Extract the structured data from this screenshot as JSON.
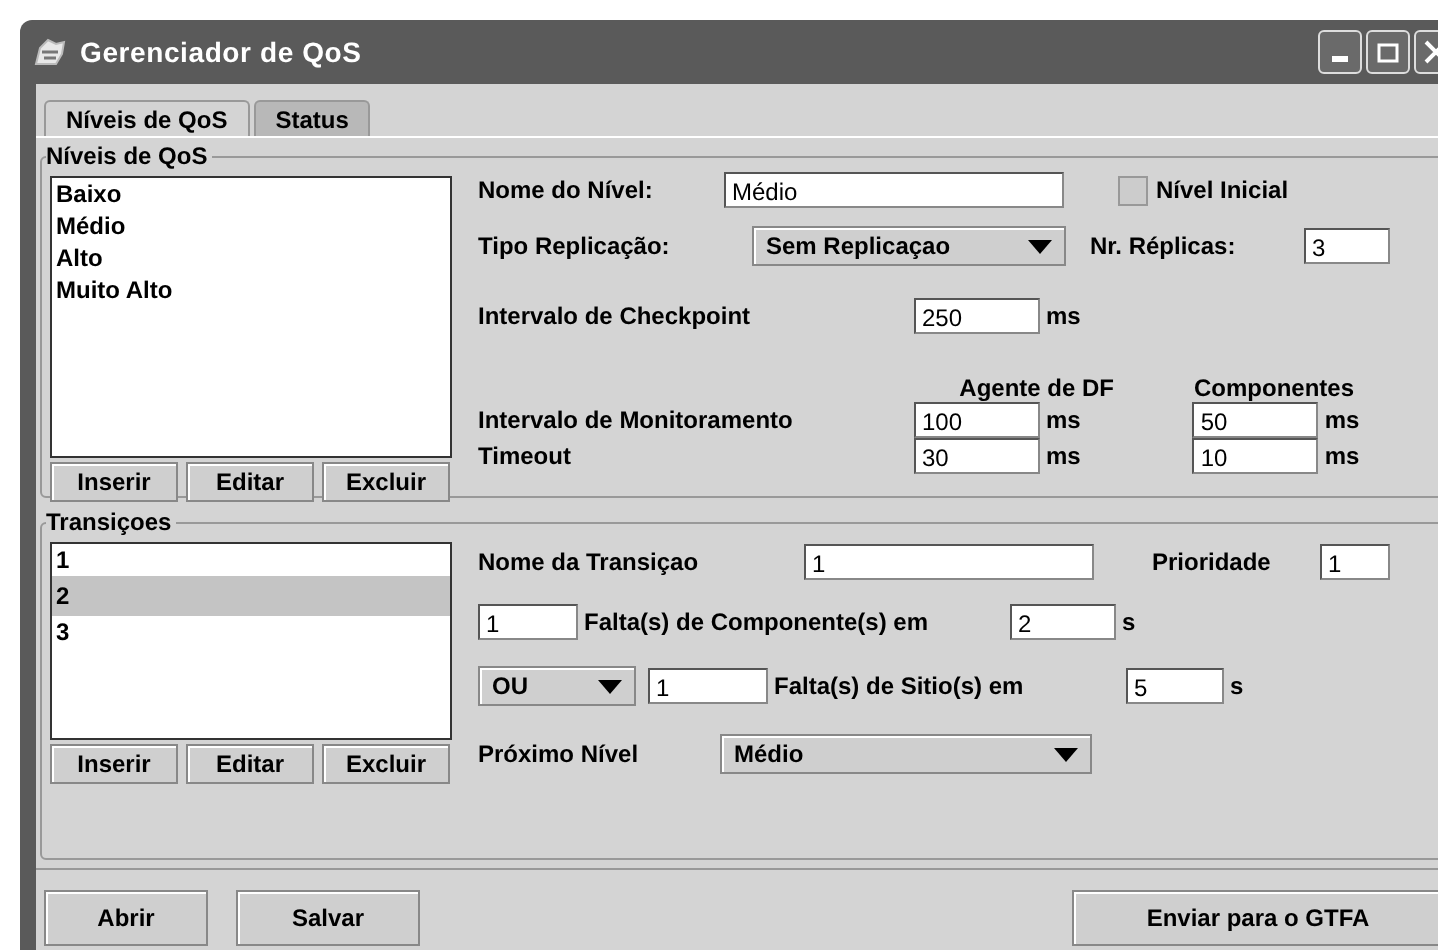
{
  "window": {
    "title": "Gerenciador de QoS"
  },
  "tabs": [
    {
      "label": "Níveis de QoS",
      "selected": true
    },
    {
      "label": "Status",
      "selected": false
    }
  ],
  "levels": {
    "title": "Níveis de QoS",
    "list": [
      {
        "label": "Baixo",
        "selected": false
      },
      {
        "label": "Médio",
        "selected": false
      },
      {
        "label": "Alto",
        "selected": false
      },
      {
        "label": "Muito Alto",
        "selected": false
      }
    ],
    "buttons": [
      "Inserir",
      "Editar",
      "Excluir"
    ],
    "name_label": "Nome do Nível:",
    "name_value": "Médio",
    "initial": {
      "label": "Nível Inicial",
      "checked": false
    },
    "type_label": "Tipo Replicação:",
    "type_value": "Sem Replicaçao",
    "replicas_label": "Nr. Réplicas:",
    "replicas_value": "3",
    "checkpoint_label": "Intervalo de Checkpoint",
    "checkpoint_value": "250",
    "checkpoint_unit": "ms",
    "column_headers": [
      "Agente de DF",
      "Componentes"
    ],
    "rows": [
      {
        "label": "Intervalo de Monitoramento",
        "cells": [
          {
            "value": "100",
            "unit": "ms"
          },
          {
            "value": "50",
            "unit": "ms"
          }
        ]
      },
      {
        "label": "Timeout",
        "cells": [
          {
            "value": "30",
            "unit": "ms"
          },
          {
            "value": "10",
            "unit": "ms"
          }
        ]
      }
    ]
  },
  "transitions": {
    "title": "Transiçoes",
    "list": [
      {
        "label": "1",
        "selected": false
      },
      {
        "label": "2",
        "selected": true
      },
      {
        "label": "3",
        "selected": false
      }
    ],
    "buttons": [
      "Inserir",
      "Editar",
      "Excluir"
    ],
    "name_label": "Nome da Transiçao",
    "name_value": "1",
    "priority_label": "Prioridade",
    "priority_value": "1",
    "component_faults": {
      "count": "1",
      "label": "Falta(s) de Componente(s) em",
      "time": "2",
      "unit": "s"
    },
    "site_faults": {
      "operator": "OU",
      "count": "1",
      "label": "Falta(s) de Sitio(s) em",
      "time": "5",
      "unit": "s"
    },
    "next_label": "Próximo Nível",
    "next_value": "Médio"
  },
  "footer_buttons": {
    "left": [
      "Abrir",
      "Salvar"
    ],
    "right": "Enviar para o GTFA"
  }
}
